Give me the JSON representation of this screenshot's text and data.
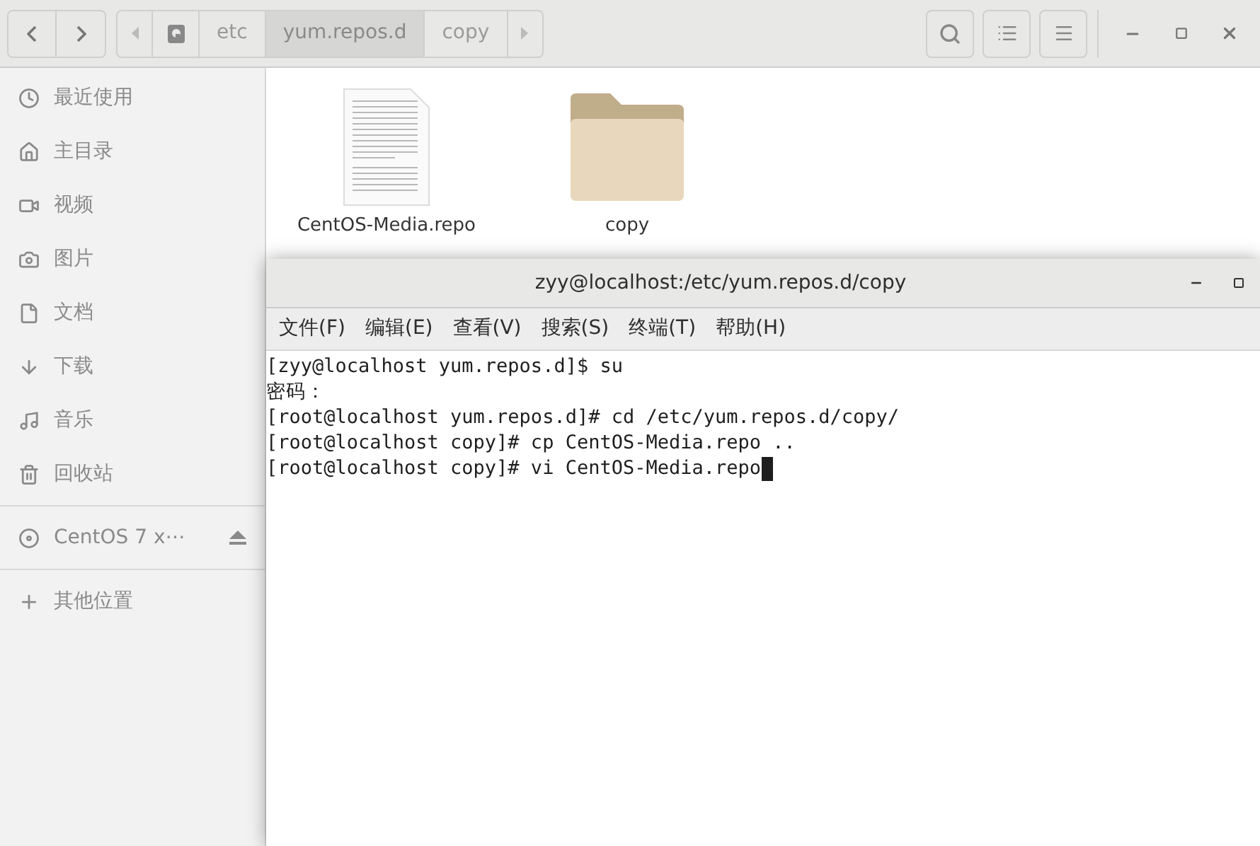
{
  "path_bar": [
    {
      "label": "etc",
      "selected": false
    },
    {
      "label": "yum.repos.d",
      "selected": true
    },
    {
      "label": "copy",
      "selected": false
    }
  ],
  "sidebar": {
    "places": [
      {
        "label": "最近使用",
        "kind": "recent"
      },
      {
        "label": "主目录",
        "kind": "home"
      },
      {
        "label": "视频",
        "kind": "video"
      },
      {
        "label": "图片",
        "kind": "pictures"
      },
      {
        "label": "文档",
        "kind": "documents"
      },
      {
        "label": "下载",
        "kind": "downloads"
      },
      {
        "label": "音乐",
        "kind": "music"
      },
      {
        "label": "回收站",
        "kind": "trash"
      }
    ],
    "devices": [
      {
        "label": "CentOS 7 x⋯",
        "kind": "disc"
      }
    ],
    "other": [
      {
        "label": "其他位置",
        "kind": "other"
      }
    ]
  },
  "files": [
    {
      "name": "CentOS-Media.repo",
      "kind": "document"
    },
    {
      "name": "copy",
      "kind": "folder"
    }
  ],
  "terminal": {
    "title": "zyy@localhost:/etc/yum.repos.d/copy",
    "menu": [
      "文件(F)",
      "编辑(E)",
      "查看(V)",
      "搜索(S)",
      "终端(T)",
      "帮助(H)"
    ],
    "lines": [
      "[zyy@localhost yum.repos.d]$ su",
      "密码：",
      "[root@localhost yum.repos.d]# cd /etc/yum.repos.d/copy/",
      "[root@localhost copy]# cp CentOS-Media.repo ..",
      "[root@localhost copy]# vi CentOS-Media.repo"
    ]
  }
}
